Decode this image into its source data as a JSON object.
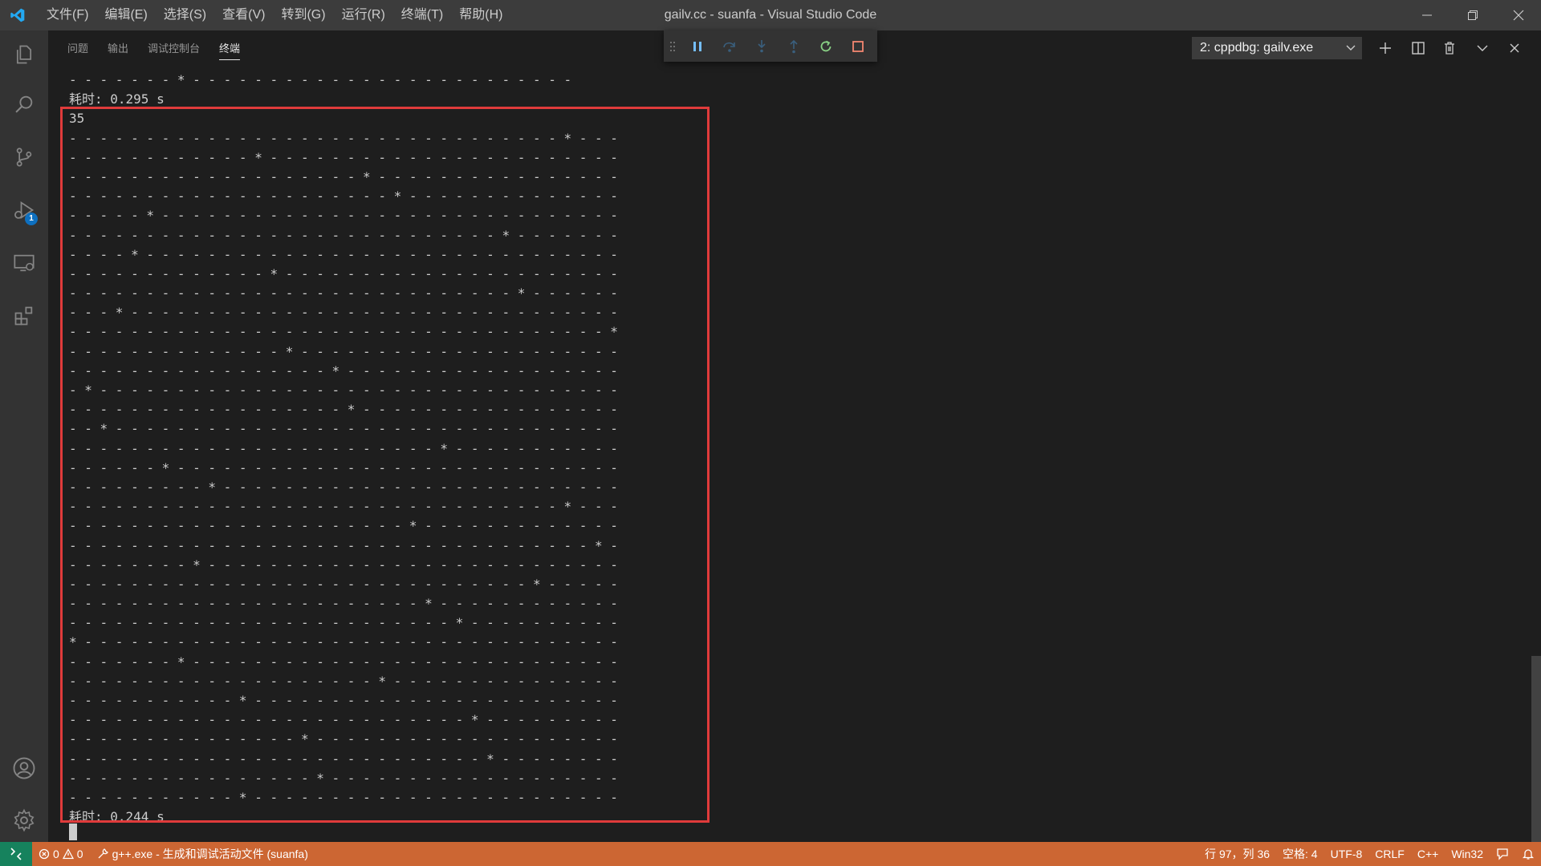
{
  "titlebar": {
    "title": "gailv.cc - suanfa - Visual Studio Code",
    "menus": [
      "文件(F)",
      "编辑(E)",
      "选择(S)",
      "查看(V)",
      "转到(G)",
      "运行(R)",
      "终端(T)",
      "帮助(H)"
    ]
  },
  "activitybar": {
    "debug_badge": "1",
    "icons": [
      "explorer-icon",
      "search-icon",
      "source-control-icon",
      "run-debug-icon",
      "remote-explorer-icon",
      "extensions-icon",
      "account-icon",
      "settings-gear-icon"
    ]
  },
  "panel": {
    "tabs": [
      "问题",
      "输出",
      "调试控制台",
      "终端"
    ],
    "active_tab": "终端",
    "terminal_select": "2: cppdbg: gailv.exe"
  },
  "terminal": {
    "lines": [
      "- - - - - - - * - - - - - - - - - - - - - - - - - - - - - - - - -",
      "耗时: 0.295 s",
      "35",
      "- - - - - - - - - - - - - - - - - - - - - - - - - - - - - - - - * - - -",
      "- - - - - - - - - - - - * - - - - - - - - - - - - - - - - - - - - - - -",
      "- - - - - - - - - - - - - - - - - - - * - - - - - - - - - - - - - - - -",
      "- - - - - - - - - - - - - - - - - - - - - * - - - - - - - - - - - - - -",
      "- - - - - * - - - - - - - - - - - - - - - - - - - - - - - - - - - - - -",
      "- - - - - - - - - - - - - - - - - - - - - - - - - - - - * - - - - - - -",
      "- - - - * - - - - - - - - - - - - - - - - - - - - - - - - - - - - - - -",
      "- - - - - - - - - - - - - * - - - - - - - - - - - - - - - - - - - - - -",
      "- - - - - - - - - - - - - - - - - - - - - - - - - - - - - * - - - - - -",
      "- - - * - - - - - - - - - - - - - - - - - - - - - - - - - - - - - - - -",
      "- - - - - - - - - - - - - - - - - - - - - - - - - - - - - - - - - - - *",
      "- - - - - - - - - - - - - - * - - - - - - - - - - - - - - - - - - - - -",
      "- - - - - - - - - - - - - - - - - * - - - - - - - - - - - - - - - - - -",
      "- * - - - - - - - - - - - - - - - - - - - - - - - - - - - - - - - - - -",
      "- - - - - - - - - - - - - - - - - - * - - - - - - - - - - - - - - - - -",
      "- - * - - - - - - - - - - - - - - - - - - - - - - - - - - - - - - - - -",
      "- - - - - - - - - - - - - - - - - - - - - - - - * - - - - - - - - - - -",
      "- - - - - - * - - - - - - - - - - - - - - - - - - - - - - - - - - - - -",
      "- - - - - - - - - * - - - - - - - - - - - - - - - - - - - - - - - - - -",
      "- - - - - - - - - - - - - - - - - - - - - - - - - - - - - - - - * - - -",
      "- - - - - - - - - - - - - - - - - - - - - - * - - - - - - - - - - - - -",
      "- - - - - - - - - - - - - - - - - - - - - - - - - - - - - - - - - - * -",
      "- - - - - - - - * - - - - - - - - - - - - - - - - - - - - - - - - - - -",
      "- - - - - - - - - - - - - - - - - - - - - - - - - - - - - - * - - - - -",
      "- - - - - - - - - - - - - - - - - - - - - - - * - - - - - - - - - - - -",
      "- - - - - - - - - - - - - - - - - - - - - - - - - * - - - - - - - - - -",
      "* - - - - - - - - - - - - - - - - - - - - - - - - - - - - - - - - - - -",
      "- - - - - - - * - - - - - - - - - - - - - - - - - - - - - - - - - - - -",
      "- - - - - - - - - - - - - - - - - - - - * - - - - - - - - - - - - - - -",
      "- - - - - - - - - - - * - - - - - - - - - - - - - - - - - - - - - - - -",
      "- - - - - - - - - - - - - - - - - - - - - - - - - - * - - - - - - - - -",
      "- - - - - - - - - - - - - - - * - - - - - - - - - - - - - - - - - - - -",
      "- - - - - - - - - - - - - - - - - - - - - - - - - - - * - - - - - - - -",
      "- - - - - - - - - - - - - - - - * - - - - - - - - - - - - - - - - - - -",
      "- - - - - - - - - - - * - - - - - - - - - - - - - - - - - - - - - - - -",
      "耗时: 0.244 s"
    ]
  },
  "statusbar": {
    "errors": "0",
    "warnings": "0",
    "task": "g++.exe - 生成和调试活动文件 (suanfa)",
    "position": "行 97，列 36",
    "spaces": "空格: 4",
    "encoding": "UTF-8",
    "eol": "CRLF",
    "language": "C++",
    "platform": "Win32"
  },
  "colors": {
    "statusbar": "#cc6633",
    "highlight_box": "#e03b3b",
    "remote": "#16825d"
  }
}
